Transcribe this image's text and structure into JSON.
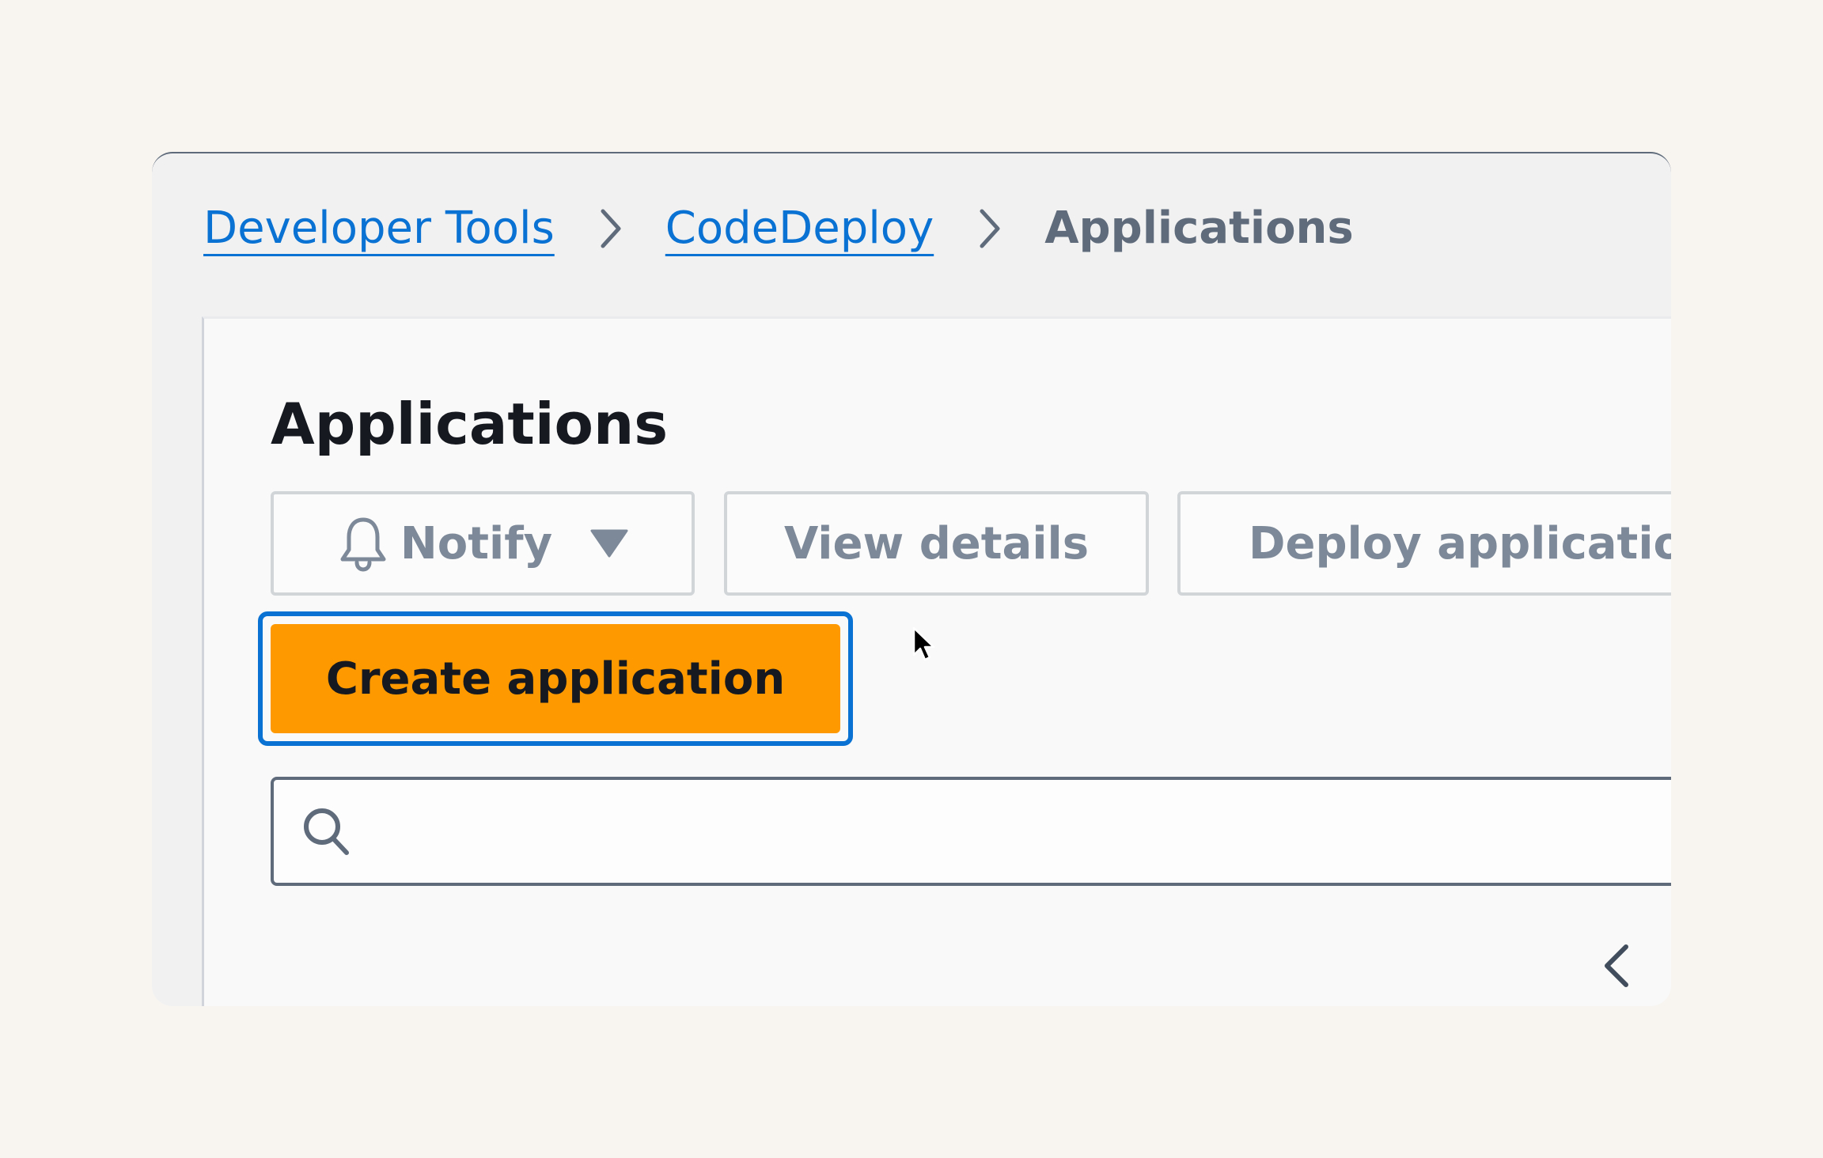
{
  "breadcrumb": {
    "items": [
      {
        "label": "Developer Tools"
      },
      {
        "label": "CodeDeploy"
      }
    ],
    "current": "Applications",
    "separator_icon": "chevron-right-icon"
  },
  "panel": {
    "title": "Applications"
  },
  "actions": {
    "notify_label": "Notify",
    "notify_icon": "bell-icon",
    "notify_dropdown_icon": "caret-down-icon",
    "view_details_label": "View details",
    "deploy_label": "Deploy application",
    "create_label": "Create application"
  },
  "search": {
    "value": "",
    "icon": "search-icon"
  },
  "pagination": {
    "prev_icon": "chevron-left-icon"
  },
  "colors": {
    "link": "#0972d3",
    "primary_button": "#ff9900",
    "focus_ring": "#0972d3",
    "disabled_text": "#7d8998",
    "heading": "#16191f"
  }
}
